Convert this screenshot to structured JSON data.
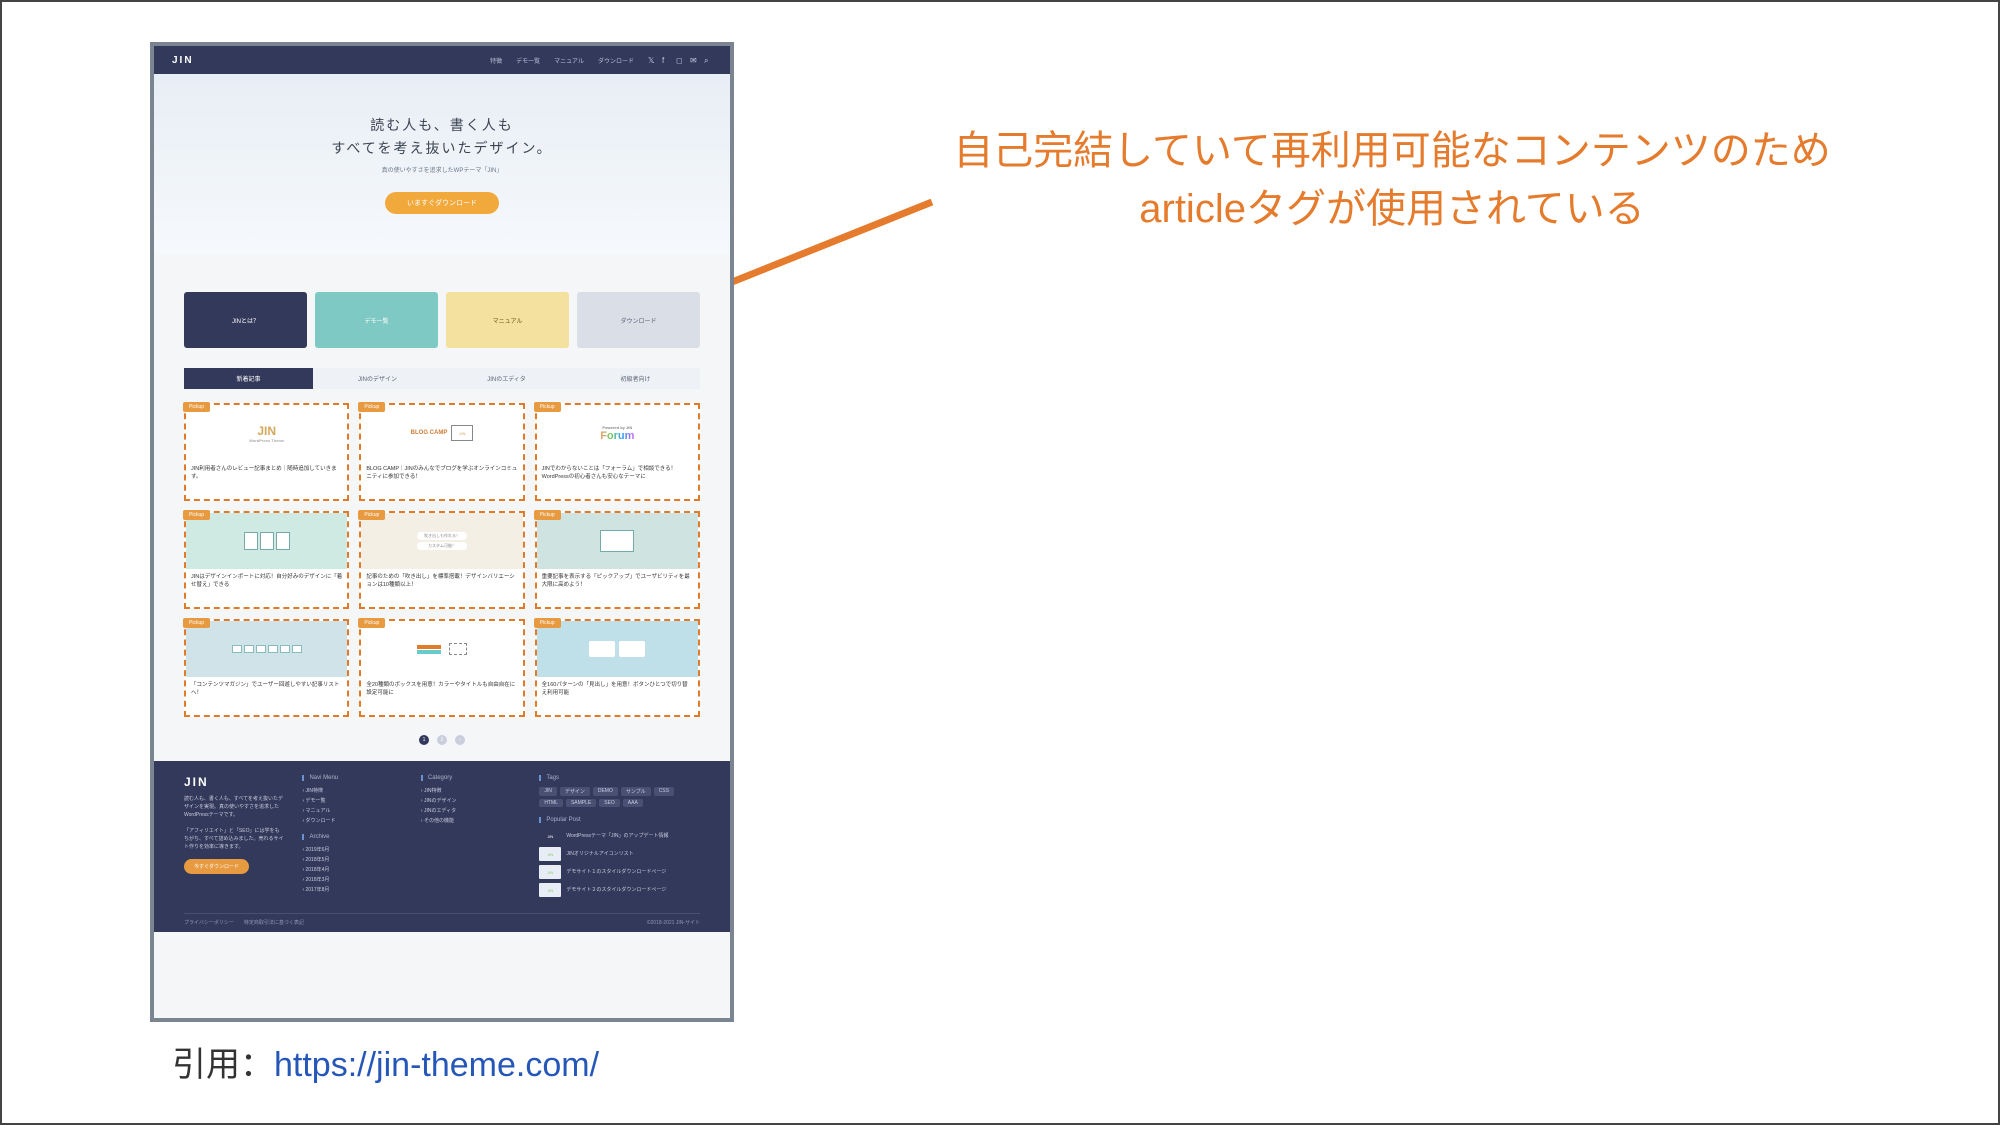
{
  "annotation": {
    "line1": "自己完結していて再利用可能なコンテンツのため",
    "line2": "articleタグが使用されている"
  },
  "citation": {
    "label": "引用：",
    "url": "https://jin-theme.com/"
  },
  "site": {
    "logo": "JIN",
    "nav": [
      "特徴",
      "デモ一覧",
      "マニュアル",
      "ダウンロード"
    ],
    "hero": {
      "line1": "読む人も、書く人も",
      "line2": "すべてを考え抜いたデザイン。",
      "sub": "真の使いやすさを追求したWPテーマ「JIN」",
      "cta": "いますぐダウンロード"
    },
    "features": [
      {
        "label": "JINとは？",
        "cls": "navy"
      },
      {
        "label": "デモ一覧",
        "cls": "teal"
      },
      {
        "label": "マニュアル",
        "cls": "yel"
      },
      {
        "label": "ダウンロード",
        "cls": "gray"
      }
    ],
    "tabs": [
      "新着記事",
      "JINのデザイン",
      "JINのエディタ",
      "初級者向け"
    ],
    "activeTab": 0,
    "badge": "Pickup",
    "articles": [
      {
        "thumb": "jin",
        "title": "JIN利用者さんのレビュー記事まとめ｜随時追加していきます。"
      },
      {
        "thumb": "camp",
        "title": "BLOG CAMP｜JINのみんなでブログを学ぶオンラインコミュニティに参加できる！"
      },
      {
        "thumb": "forum",
        "title": "JINでわからないことは「フォーラム」で相談できる！WordPressの初心者さんも安心なテーマに"
      },
      {
        "thumb": "pick",
        "title": "JINはデザインインポートに対応！自分好みのデザインに「着せ替え」できる"
      },
      {
        "thumb": "head",
        "title": "記事のための「吹き出し」を標準搭載！デザインバリエーションは10種類以上！"
      },
      {
        "thumb": "wide",
        "title": "重要記事を表示する「ピックアップ」でユーザビリティを最大限に高めよう！"
      },
      {
        "thumb": "mag",
        "title": "「コンテンツマガジン」でユーザー回遊しやすい記事リストへ！"
      },
      {
        "thumb": "box",
        "title": "全20種類のボックスを用意！カラーやタイトルも自由自在に設定可能に"
      },
      {
        "thumb": "patt",
        "title": "全160パターンの「見出し」を用意！ボタンひとつで切り替え利用可能"
      }
    ],
    "pager": [
      "1",
      "2",
      "›"
    ],
    "footer": {
      "logo": "JIN",
      "desc1": "読む人も、書く人も、すべてを考え抜いたデザインを実現。真の使いやすさを追求したWordPressテーマです。",
      "desc2": "「アフィリエイト」と「SEO」には学をもちがち、すべて詰め込みました。売れるサイト作りを効率に導きます。",
      "cta": "今すぐダウンロード",
      "menu_hd": "Navi Menu",
      "menu": [
        "JIN特徴",
        "デモ一覧",
        "マニュアル",
        "ダウンロード"
      ],
      "cat_hd": "Category",
      "cat": [
        "JIN特徴",
        "JINのデザイン",
        "JINのエディタ",
        "その他の機能"
      ],
      "arc_hd": "Archive",
      "arc": [
        "2019年6月",
        "2018年5月",
        "2018年4月",
        "2018年3月",
        "2017年8月"
      ],
      "tag_hd": "Tags",
      "tags": [
        "JIN",
        "デザイン",
        "DEMO",
        "サンプル",
        "CSS",
        "HTML",
        "SAMPLE",
        "SEO",
        "AAA"
      ],
      "pop_hd": "Popular Post",
      "pop": [
        "WordPressテーマ「JIN」のアップデート情報",
        "JINオリジナルアイコンリスト",
        "デモサイト１のスタイルダウンロードページ",
        "デモサイト２のスタイルダウンロードページ"
      ],
      "bar": {
        "links": [
          "プライバシーポリシー",
          "特定商取引法に基づく表記"
        ],
        "copy": "©2018-2021 JIN-サイト"
      }
    }
  }
}
